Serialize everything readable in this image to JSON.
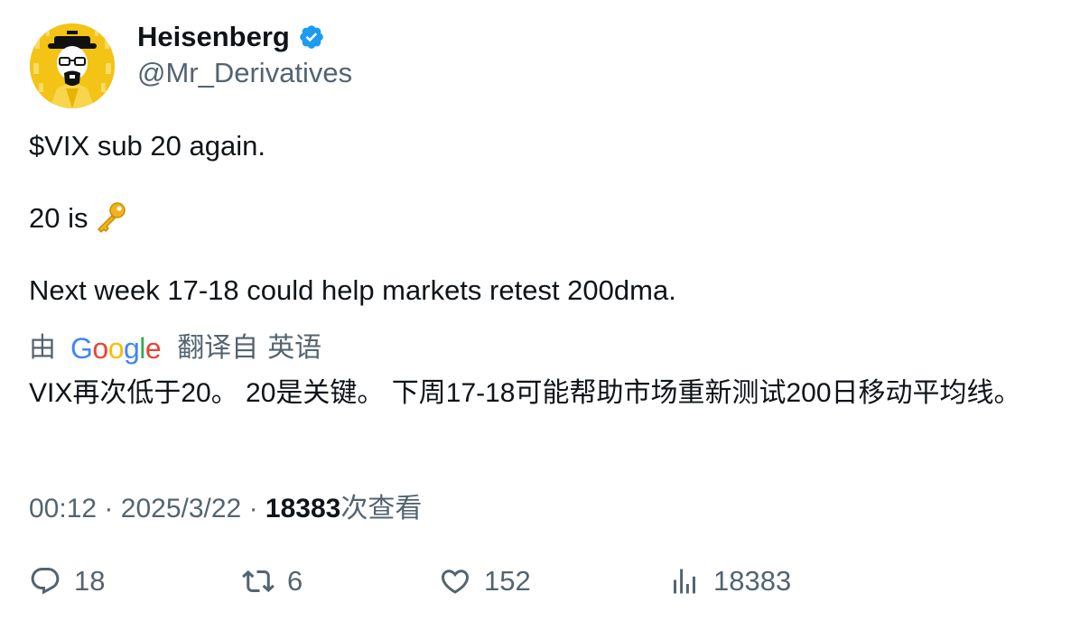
{
  "author": {
    "display_name": "Heisenberg",
    "handle": "@Mr_Derivatives",
    "avatar_icon": "heisenberg-avatar",
    "verified_icon": "verified-badge-icon",
    "verified_color": "#1d9bf0"
  },
  "tweet": {
    "line1": "$VIX sub 20 again.",
    "line2": "20 is",
    "line2_emoji": "key-emoji",
    "line3": "Next week 17-18 could help markets retest 200dma."
  },
  "translation": {
    "by_label": "由",
    "google_letters": [
      "G",
      "o",
      "o",
      "g",
      "l",
      "e"
    ],
    "translated_from_label": "翻译自",
    "source_language": "英语",
    "text": "VIX再次低于20。 20是关键。 下周17-18可能帮助市场重新测试200日移动平均线。"
  },
  "meta": {
    "time": "00:12",
    "separator": "·",
    "date": "2025/3/22",
    "views_count": "18383",
    "views_label": "次查看"
  },
  "actions": {
    "replies": "18",
    "retweets": "6",
    "likes": "152",
    "views": "18383"
  },
  "colors": {
    "text_primary": "#0f1419",
    "text_secondary": "#536471",
    "avatar_background": "#f3c316"
  }
}
